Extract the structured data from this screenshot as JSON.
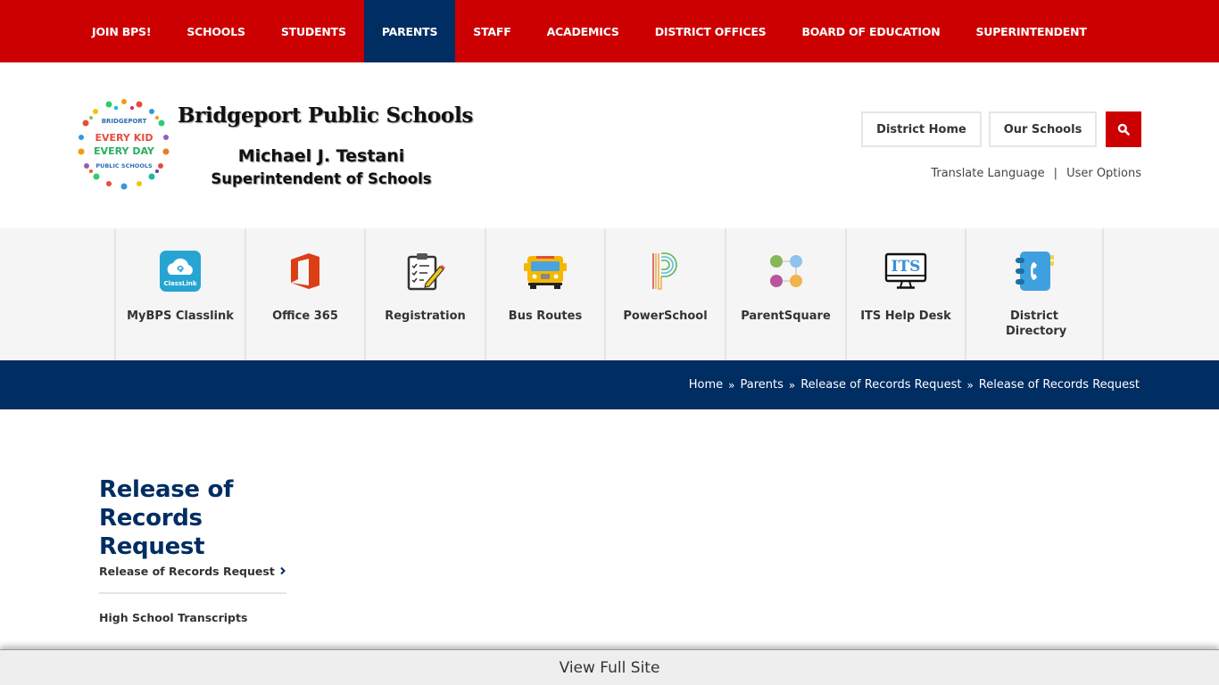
{
  "topnav": {
    "items": [
      {
        "label": "JOIN BPS!"
      },
      {
        "label": "SCHOOLS"
      },
      {
        "label": "STUDENTS"
      },
      {
        "label": "PARENTS",
        "active": true
      },
      {
        "label": "STAFF"
      },
      {
        "label": "ACADEMICS"
      },
      {
        "label": "DISTRICT OFFICES"
      },
      {
        "label": "BOARD OF EDUCATION"
      },
      {
        "label": "SUPERINTENDENT"
      }
    ],
    "bg_color": "#cc0000",
    "active_color": "#002d62"
  },
  "header": {
    "logo": {
      "badge_top": "BRIDGEPORT",
      "badge_line1": "EVERY KID",
      "badge_line2": "EVERY DAY",
      "badge_bottom": "PUBLIC SCHOOLS",
      "title": "Bridgeport Public Schools",
      "subtitle1": "Michael J. Testani",
      "subtitle2": "Superintendent of Schools"
    },
    "buttons": {
      "district_home": "District Home",
      "our_schools": "Our Schools",
      "search_icon": "search-icon"
    },
    "utility": {
      "translate": "Translate Language",
      "separator": "|",
      "user_options": "User Options"
    }
  },
  "quicklinks": [
    {
      "label": "MyBPS Classlink",
      "icon": "classlink-icon"
    },
    {
      "label": "Office 365",
      "icon": "office365-icon"
    },
    {
      "label": "Registration",
      "icon": "clipboard-icon"
    },
    {
      "label": "Bus Routes",
      "icon": "school-bus-icon"
    },
    {
      "label": "PowerSchool",
      "icon": "powerschool-icon"
    },
    {
      "label": "ParentSquare",
      "icon": "parentsquare-icon"
    },
    {
      "label": "ITS Help Desk",
      "icon": "monitor-icon"
    },
    {
      "label": "District Directory",
      "icon": "phonebook-icon"
    }
  ],
  "breadcrumb": {
    "items": [
      "Home",
      "Parents",
      "Release of Records Request",
      "Release of Records Request"
    ],
    "separator": "»"
  },
  "sidebar": {
    "title": "Release of Records Request",
    "items": [
      {
        "label": "Release of Records Request",
        "active": true
      },
      {
        "label": "High School Transcripts"
      }
    ]
  },
  "footer": {
    "view_full_site": "View Full Site"
  }
}
